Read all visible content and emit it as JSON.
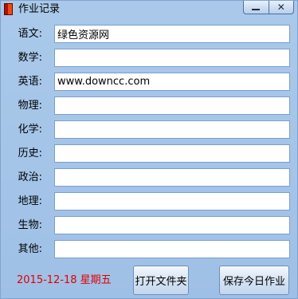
{
  "window": {
    "title": "作业记录",
    "minimize_label": "—",
    "close_label": "✕",
    "icon": "notebook-icon"
  },
  "rows": [
    {
      "label": "语文:",
      "value": "绿色资源网"
    },
    {
      "label": "数学:",
      "value": ""
    },
    {
      "label": "英语:",
      "value": "www.downcc.com"
    },
    {
      "label": "物理:",
      "value": ""
    },
    {
      "label": "化学:",
      "value": ""
    },
    {
      "label": "历史:",
      "value": ""
    },
    {
      "label": "政治:",
      "value": ""
    },
    {
      "label": "地理:",
      "value": ""
    },
    {
      "label": "生物:",
      "value": ""
    },
    {
      "label": "其他:",
      "value": ""
    }
  ],
  "footer": {
    "date": "2015-12-18  星期五",
    "open_folder_label": "打开文件夹",
    "save_label": "保存今日作业"
  },
  "colors": {
    "background": "#a6c7ea",
    "date_text": "#e00000",
    "field_border": "#7a9fce"
  }
}
